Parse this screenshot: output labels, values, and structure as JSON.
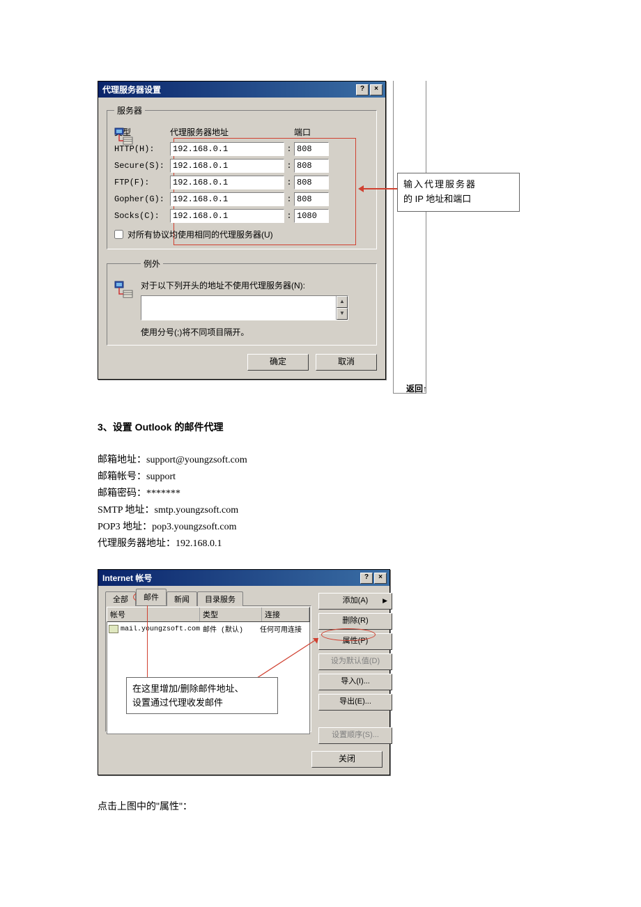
{
  "dlg1": {
    "title": "代理服务器设置",
    "help_btn": "?",
    "close_btn": "×",
    "fs_server_legend": "服务器",
    "head_type": "类型",
    "head_addr": "代理服务器地址",
    "head_port": "端口",
    "rows": [
      {
        "label": "HTTP(H):",
        "addr": "192.168.0.1",
        "port": "808"
      },
      {
        "label": "Secure(S):",
        "addr": "192.168.0.1",
        "port": "808"
      },
      {
        "label": "FTP(F):",
        "addr": "192.168.0.1",
        "port": "808"
      },
      {
        "label": "Gopher(G):",
        "addr": "192.168.0.1",
        "port": "808"
      },
      {
        "label": "Socks(C):",
        "addr": "192.168.0.1",
        "port": "1080"
      }
    ],
    "chk_same": "对所有协议均使用相同的代理服务器(U)",
    "fs_except_legend": "例外",
    "except_note": "对于以下列开头的地址不使用代理服务器(N):",
    "sep_hint": "使用分号(;)将不同项目隔开。",
    "ok": "确定",
    "cancel": "取消"
  },
  "callout1": {
    "line1": "输入代理服务器",
    "line2": "的 IP 地址和端口"
  },
  "back_label": "返回↑",
  "section3": {
    "heading": "3、设置 Outlook 的邮件代理",
    "lines": [
      "邮箱地址：support@youngzsoft.com",
      "邮箱帐号：support",
      "邮箱密码：*******",
      "SMTP 地址：smtp.youngzsoft.com",
      "POP3 地址：pop3.youngzsoft.com",
      "代理服务器地址：192.168.0.1"
    ]
  },
  "dlg2": {
    "title": "Internet 帐号",
    "help_btn": "?",
    "close_btn": "×",
    "tabs": {
      "all": "全部",
      "mail": "邮件",
      "news": "新闻",
      "dir": "目录服务"
    },
    "list_head": {
      "account": "帐号",
      "type": "类型",
      "conn": "连接"
    },
    "list_row": {
      "account": "mail.youngzsoft.com",
      "type": "邮件 (默认)",
      "conn": "任何可用连接"
    },
    "buttons": {
      "add": "添加(A)",
      "remove": "删除(R)",
      "props": "属性(P)",
      "setdef": "设为默认值(D)",
      "import": "导入(I)...",
      "export": "导出(E)...",
      "order": "设置顺序(S)...",
      "close": "关闭"
    }
  },
  "callout2": {
    "line1": "在这里增加/删除邮件地址、",
    "line2": "设置通过代理收发邮件"
  },
  "trailing": "点击上图中的\"属性\"："
}
